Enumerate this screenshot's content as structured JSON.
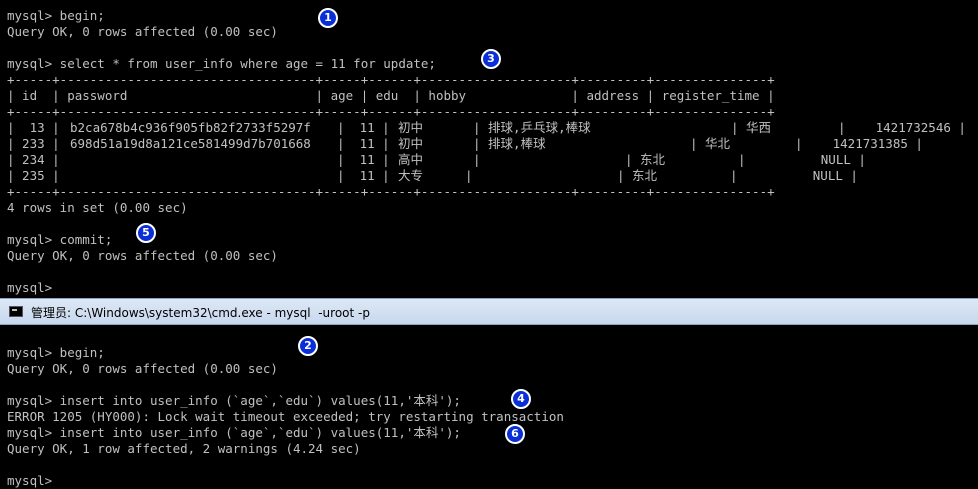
{
  "top_terminal": {
    "lines": [
      "mysql> begin;",
      "Query OK, 0 rows affected (0.00 sec)",
      "",
      "mysql> select * from user_info where age = 11 for update;",
      "+-----+----------------------------------+-----+------+--------------------+---------+---------------+",
      "| id  | password                         | age | edu  | hobby              | address | register_time |",
      "+-----+----------------------------------+-----+------+--------------------+---------+---------------+",
      "",
      "",
      "",
      "",
      "+-----+----------------------------------+-----+------+--------------------+---------+---------------+",
      "",
      "4 rows in set (0.00 sec)",
      "",
      "mysql> commit;",
      "Query OK, 0 rows affected (0.00 sec)",
      "",
      "mysql>"
    ],
    "rows": [
      {
        "id": "|  13 |",
        "password": "b2ca678b4c936f905fb82f2733f5297f",
        "age": "|  11 |",
        "edu": "初中",
        "hobby": "| 排球,乒乓球,棒球",
        "address": "| 华西",
        "register_time": "|    1421732546 |"
      },
      {
        "id": "| 233 |",
        "password": "698d51a19d8a121ce581499d7b701668",
        "age": "|  11 |",
        "edu": "初中",
        "hobby": "| 排球,棒球",
        "address": "| 华北",
        "register_time": "|    1421731385 |"
      },
      {
        "id": "| 234 |",
        "password": "",
        "age": "|  11 |",
        "edu": "高中",
        "hobby": "|",
        "address": "| 东北",
        "register_time": "|          NULL |"
      },
      {
        "id": "| 235 |",
        "password": "",
        "age": "|  11 |",
        "edu": "大专",
        "hobby": "|",
        "address": "| 东北",
        "register_time": "|          NULL |"
      }
    ]
  },
  "window": {
    "title": "管理员: C:\\Windows\\system32\\cmd.exe - mysql  -uroot -p"
  },
  "bottom_terminal": {
    "lines": [
      "",
      "mysql> begin;",
      "Query OK, 0 rows affected (0.00 sec)",
      "",
      "mysql> insert into user_info (`age`,`edu`) values(11,'本科');",
      "ERROR 1205 (HY000): Lock wait timeout exceeded; try restarting transaction",
      "mysql> insert into user_info (`age`,`edu`) values(11,'本科');",
      "Query OK, 1 row affected, 2 warnings (4.24 sec)",
      "",
      "mysql>"
    ]
  },
  "badges": [
    "1",
    "2",
    "3",
    "4",
    "5",
    "6"
  ]
}
